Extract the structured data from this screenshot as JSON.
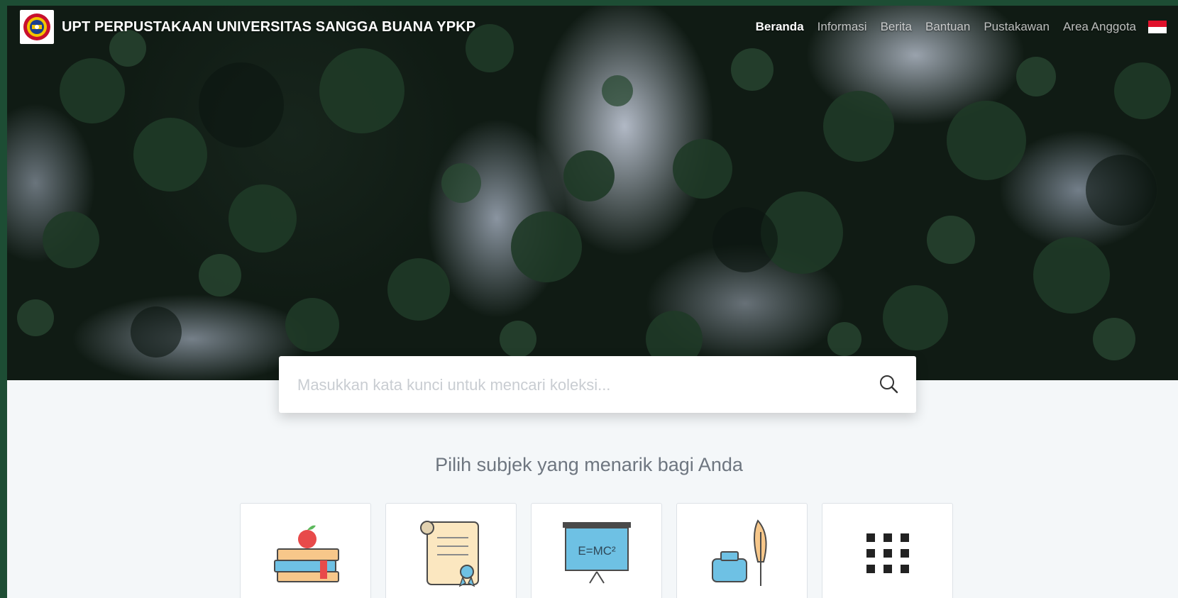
{
  "header": {
    "site_title": "UPT PERPUSTAKAAN UNIVERSITAS SANGGA BUANA YPKP",
    "logo_icon": "university-logo",
    "nav": [
      {
        "label": "Beranda",
        "active": true
      },
      {
        "label": "Informasi",
        "active": false
      },
      {
        "label": "Berita",
        "active": false
      },
      {
        "label": "Bantuan",
        "active": false
      },
      {
        "label": "Pustakawan",
        "active": false
      },
      {
        "label": "Area Anggota",
        "active": false
      }
    ],
    "language_icon": "indonesia-flag-icon"
  },
  "search": {
    "placeholder": "Masukkan kata kunci untuk mencari koleksi...",
    "value": "",
    "icon": "search-icon"
  },
  "subjects": {
    "heading": "Pilih subjek yang menarik bagi Anda",
    "cards": [
      {
        "icon": "books-apple-icon"
      },
      {
        "icon": "certificate-icon"
      },
      {
        "icon": "emc2-board-icon"
      },
      {
        "icon": "ink-quill-icon"
      },
      {
        "icon": "grid-menu-icon"
      }
    ]
  },
  "colors": {
    "outer_frame": "#1d4d34",
    "page_background": "#f4f7f9",
    "nav_text": "#ffffff"
  }
}
